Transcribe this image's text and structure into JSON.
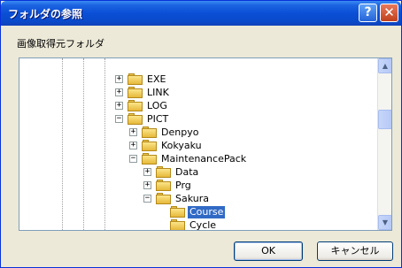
{
  "window": {
    "title": "フォルダの参照",
    "help_glyph": "?",
    "close_glyph": "✕"
  },
  "prompt": "画像取得元フォルダ",
  "tree": {
    "expander_plus": "+",
    "expander_minus": "−",
    "nodes": [
      {
        "label": "EXE",
        "expander": "plus",
        "selected": false
      },
      {
        "label": "LINK",
        "expander": "plus",
        "selected": false
      },
      {
        "label": "LOG",
        "expander": "plus",
        "selected": false
      },
      {
        "label": "PICT",
        "expander": "minus",
        "selected": false
      },
      {
        "label": "Denpyo",
        "expander": "plus",
        "selected": false
      },
      {
        "label": "Kokyaku",
        "expander": "plus",
        "selected": false
      },
      {
        "label": "MaintenancePack",
        "expander": "minus",
        "selected": false
      },
      {
        "label": "Data",
        "expander": "plus",
        "selected": false
      },
      {
        "label": "Prg",
        "expander": "plus",
        "selected": false
      },
      {
        "label": "Sakura",
        "expander": "minus",
        "selected": false
      },
      {
        "label": "Course",
        "expander": "none",
        "selected": true
      },
      {
        "label": "Cycle",
        "expander": "none",
        "selected": false
      }
    ]
  },
  "scrollbar": {
    "up_glyph": "▲",
    "down_glyph": "▼"
  },
  "buttons": {
    "ok": "OK",
    "cancel": "キャンセル"
  }
}
